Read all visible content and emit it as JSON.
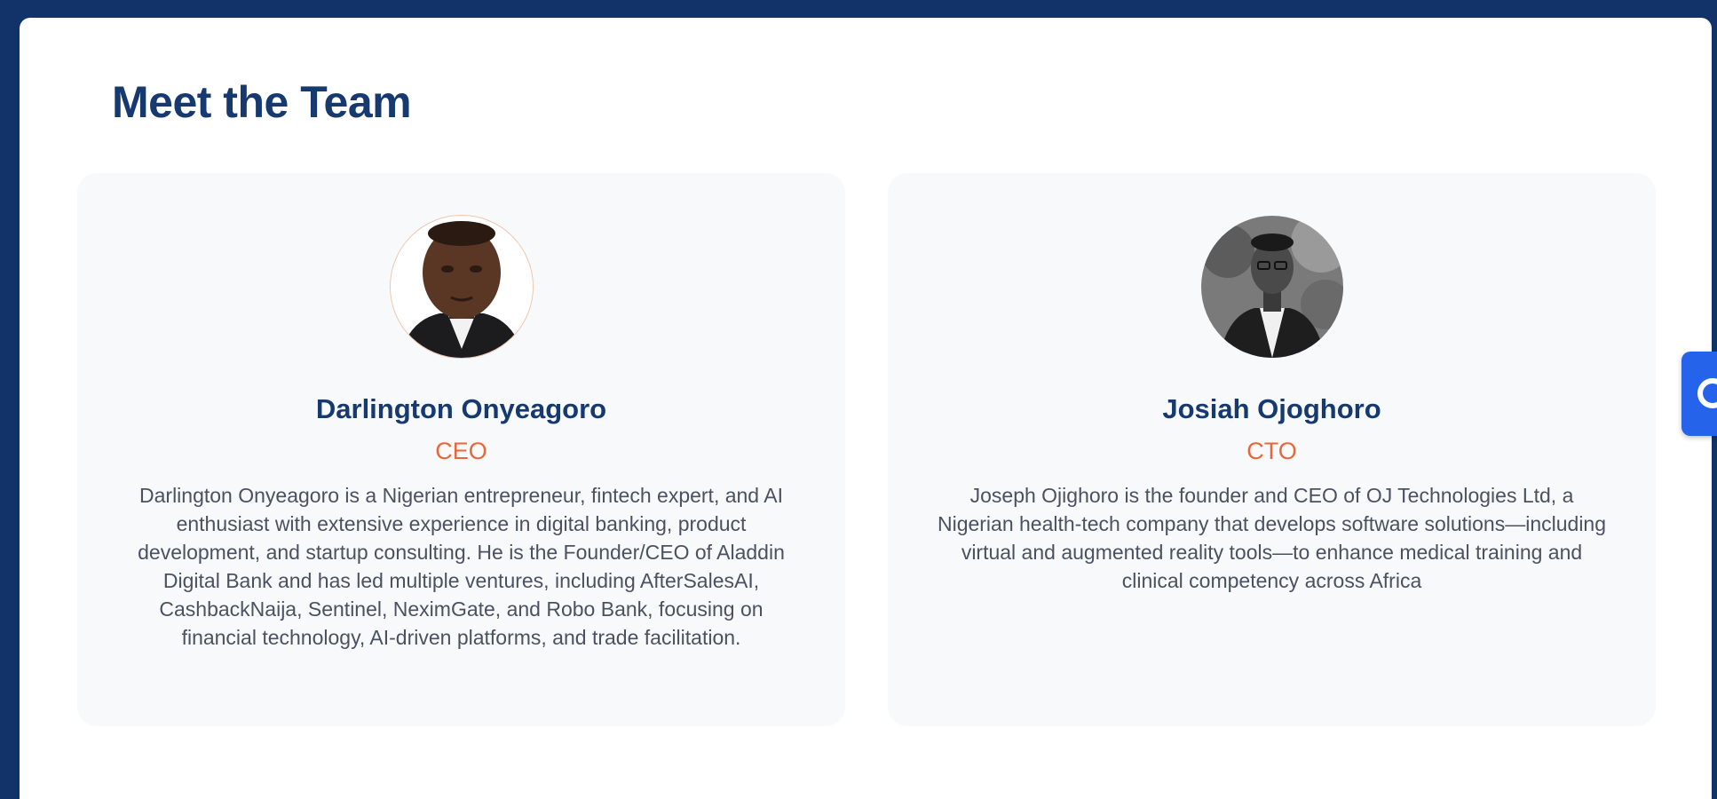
{
  "section": {
    "title": "Meet the Team"
  },
  "team": [
    {
      "name": "Darlington Onyeagoro",
      "role": "CEO",
      "bio": "Darlington Onyeagoro is a Nigerian entrepreneur, fintech expert, and AI enthusiast with extensive experience in digital banking, product development, and startup consulting. He is the Founder/CEO of Aladdin Digital Bank and has led multiple ventures, including AfterSalesAI, CashbackNaija, Sentinel, NeximGate, and Robo Bank, focusing on financial technology, AI-driven platforms, and trade facilitation."
    },
    {
      "name": "Josiah Ojoghoro",
      "role": "CTO",
      "bio": "Joseph Ojighoro is the founder and CEO of OJ Technologies Ltd, a Nigerian health-tech company that develops software solutions—including virtual and augmented reality tools—to enhance medical training and clinical competency across Africa"
    }
  ],
  "icons": {
    "side_tab": "chat-icon"
  },
  "colors": {
    "page_background": "#12336a",
    "title": "#163a70",
    "role_accent": "#e8673a",
    "side_tab": "#2563eb"
  }
}
